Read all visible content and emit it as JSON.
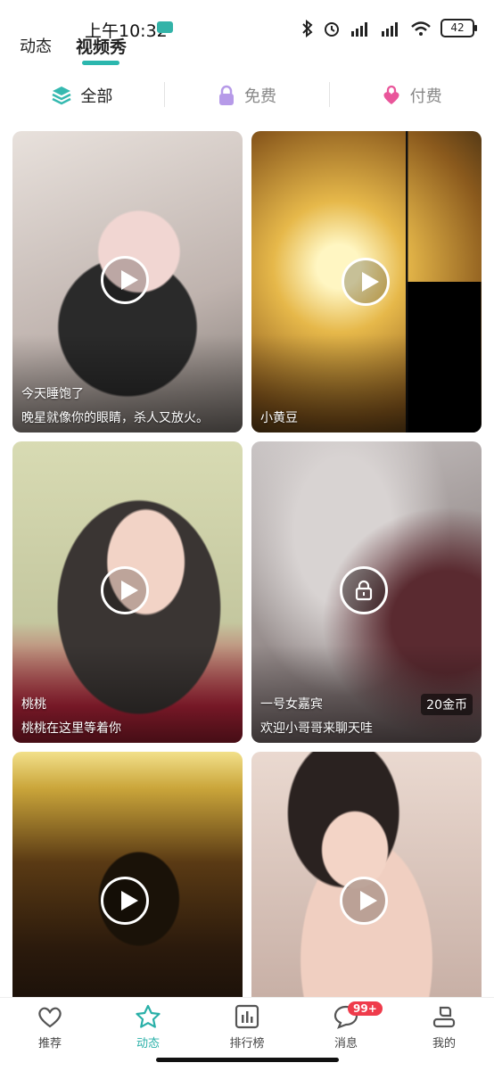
{
  "status_bar": {
    "time": "上午10:32",
    "battery": "42"
  },
  "top_tabs": [
    {
      "label": "动态"
    },
    {
      "label": "视频秀",
      "active": true
    }
  ],
  "filters": [
    {
      "label": "全部",
      "icon": "layers-icon",
      "active": true
    },
    {
      "label": "免费",
      "icon": "lock-icon"
    },
    {
      "label": "付费",
      "icon": "heart-lock-icon"
    }
  ],
  "cards": [
    {
      "title": "今天睡饱了",
      "desc": "晚星就像你的眼睛，杀人又放火。",
      "type": "play"
    },
    {
      "title": "",
      "desc": "小黄豆",
      "type": "play"
    },
    {
      "title": "桃桃",
      "desc": "桃桃在这里等着你",
      "type": "play"
    },
    {
      "title": "一号女嘉宾",
      "desc": "欢迎小哥哥来聊天哇",
      "type": "locked",
      "price": "20金币"
    },
    {
      "title": "",
      "desc": "",
      "type": "play"
    },
    {
      "title": "",
      "desc": "",
      "type": "play"
    }
  ],
  "bottom_nav": [
    {
      "label": "推荐",
      "icon": "heart-icon"
    },
    {
      "label": "动态",
      "icon": "star-icon",
      "active": true
    },
    {
      "label": "排行榜",
      "icon": "chart-icon"
    },
    {
      "label": "消息",
      "icon": "chat-icon",
      "badge": "99+"
    },
    {
      "label": "我的",
      "icon": "user-icon"
    }
  ],
  "colors": {
    "accent": "#29b0a8",
    "badge": "#ef3b4b"
  }
}
